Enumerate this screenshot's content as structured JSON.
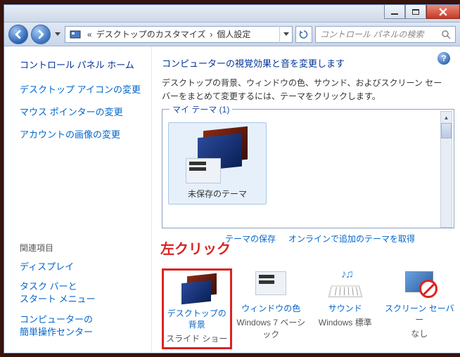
{
  "titlebar": {},
  "address_bar": {
    "prefix": "«",
    "crumb1": "デスクトップのカスタマイズ",
    "sep": "›",
    "crumb2": "個人設定"
  },
  "search": {
    "placeholder": "コントロール パネルの検索"
  },
  "sidebar": {
    "home": "コントロール パネル ホーム",
    "links": [
      "デスクトップ アイコンの変更",
      "マウス ポインターの変更",
      "アカウントの画像の変更"
    ],
    "related_header": "関連項目",
    "related": [
      "ディスプレイ",
      "タスク バーと\nスタート メニュー",
      "コンピューターの\n簡単操作センター"
    ]
  },
  "main": {
    "heading": "コンピューターの視覚効果と音を変更します",
    "description": "デスクトップの背景、ウィンドウの色、サウンド、およびスクリーン セーバーをまとめて変更するには、テーマをクリックします。",
    "my_themes_legend": "マイ テーマ (1)",
    "unsaved_theme": "未保存のテーマ",
    "save_theme": "テーマの保存",
    "get_online": "オンラインで追加のテーマを取得",
    "annotation": "左クリック",
    "options": [
      {
        "label": "デスクトップの背景",
        "sub": "スライド ショー"
      },
      {
        "label": "ウィンドウの色",
        "sub": "Windows 7 ベーシック"
      },
      {
        "label": "サウンド",
        "sub": "Windows 標準"
      },
      {
        "label": "スクリーン セーバー",
        "sub": "なし"
      }
    ]
  }
}
